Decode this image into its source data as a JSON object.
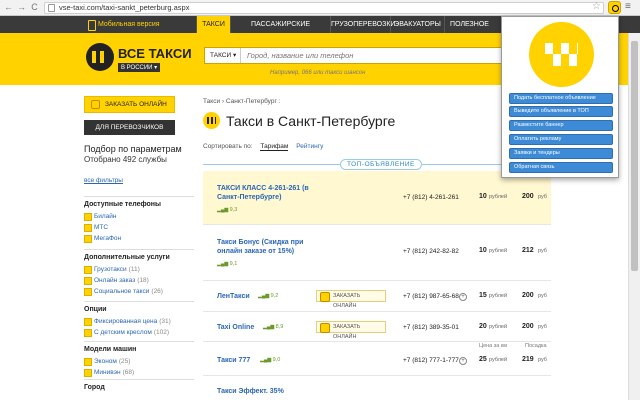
{
  "browser": {
    "back": "←",
    "forward": "→",
    "reload": "C",
    "url": "vse-taxi.com/taxi-sankt_peterburg.aspx",
    "star": "☆",
    "menu": "≡"
  },
  "topnav": {
    "mobile": "Мобильная версия",
    "items": [
      "ТАКСИ",
      "ПАССАЖИРСКИЕ ПЕРЕВОЗКИ",
      "ГРУЗОПЕРЕВОЗКИ",
      "ЭВАКУАТОРЫ",
      "ПОЛЕЗНОЕ"
    ]
  },
  "header": {
    "logo_title": "ВСЕ ТАКСИ",
    "logo_region": "В РОССИИ ▾",
    "search_select": "ТАКСИ ▾",
    "search_placeholder": "Город, название или телефон",
    "search_hint": "Например, 066 или такси шансон"
  },
  "sidebar": {
    "order_online": "ЗАКАЗАТЬ ОНЛАЙН",
    "for_carriers": "ДЛЯ ПЕРЕВОЗЧИКОВ",
    "filter_title": "Подбор по параметрам",
    "filter_count": "Отобрано 492 службы",
    "all_filters": "все фильтры",
    "sections": [
      {
        "title": "Доступные телефоны",
        "items": [
          {
            "label": "Билайн",
            "count": ""
          },
          {
            "label": "МТС",
            "count": ""
          },
          {
            "label": "МегаФон",
            "count": ""
          }
        ]
      },
      {
        "title": "Дополнительные услуги",
        "items": [
          {
            "label": "Грузотакси",
            "count": "(11)"
          },
          {
            "label": "Онлайн заказ",
            "count": "(18)"
          },
          {
            "label": "Социальное такси",
            "count": "(26)"
          }
        ]
      },
      {
        "title": "Опции",
        "items": [
          {
            "label": "Фиксированная цена",
            "count": "(31)"
          },
          {
            "label": "С детским креслом",
            "count": "(102)"
          }
        ]
      },
      {
        "title": "Модели машин",
        "items": [
          {
            "label": "Эконом",
            "count": "(25)"
          },
          {
            "label": "Минивэн",
            "count": "(68)"
          }
        ]
      },
      {
        "title": "Город",
        "items": []
      }
    ]
  },
  "main": {
    "breadcrumb": "Такси › Санкт-Петербург :",
    "title": "Такси в Санкт-Петербурге",
    "sort_label": "Сортировать по:",
    "sort_options": [
      "Тарифам",
      "Рейтингу"
    ],
    "top_badge": "ТОП-ОБЪЯВЛЕНИЕ",
    "price_hdr_a": "Цена за км",
    "price_hdr_b": "Посадка",
    "rows": [
      {
        "name": "ТАКСИ КЛАСС 4-261-261 (в Санкт-Петербурге)",
        "rating": "9,3",
        "order": "",
        "phone": "+7 (812) 4-261-261",
        "price_a": "10",
        "unit_a": "рублей",
        "price_b": "200",
        "unit_b": "руб"
      },
      {
        "name": "Такси Бонус (Скидка при онлайн заказе от 15%)",
        "rating": "9,1",
        "order": "",
        "phone": "+7 (812) 242-82-82",
        "price_a": "10",
        "unit_a": "рублей",
        "price_b": "212",
        "unit_b": "руб"
      },
      {
        "name": "ЛенТакси",
        "rating": "9,2",
        "order": "ЗАКАЗАТЬ ОНЛАЙН",
        "phone": "+7 (812) 987-65-68",
        "price_a": "15",
        "unit_a": "рублей",
        "price_b": "200",
        "unit_b": "руб"
      },
      {
        "name": "Taxi Online",
        "rating": "8,9",
        "order": "ЗАКАЗАТЬ ОНЛАЙН",
        "phone": "+7 (812) 389-35-01",
        "price_a": "20",
        "unit_a": "рублей",
        "price_b": "200",
        "unit_b": "руб"
      },
      {
        "name": "Такси 777",
        "rating": "9,0",
        "order": "",
        "phone": "+7 (812) 777-1-777",
        "price_a": "25",
        "unit_a": "рублей",
        "price_b": "219",
        "unit_b": "руб"
      },
      {
        "name": "Такси Эффект. 35%",
        "rating": "",
        "order": "",
        "phone": "",
        "price_a": "",
        "unit_a": "",
        "price_b": "",
        "unit_b": ""
      }
    ]
  },
  "popup": {
    "buttons": [
      "Подать бесплатное объявление",
      "Выведите объявление в ТОП",
      "Разместите баннер",
      "Оплатить рекламу",
      "Заявки и тендеры",
      "Обратная связь"
    ]
  },
  "colors": {
    "brand_yellow": "#ffd200",
    "dark_nav": "#3a3a3a",
    "link_blue": "#2a66b6",
    "popup_button": "#3d8ad6"
  }
}
